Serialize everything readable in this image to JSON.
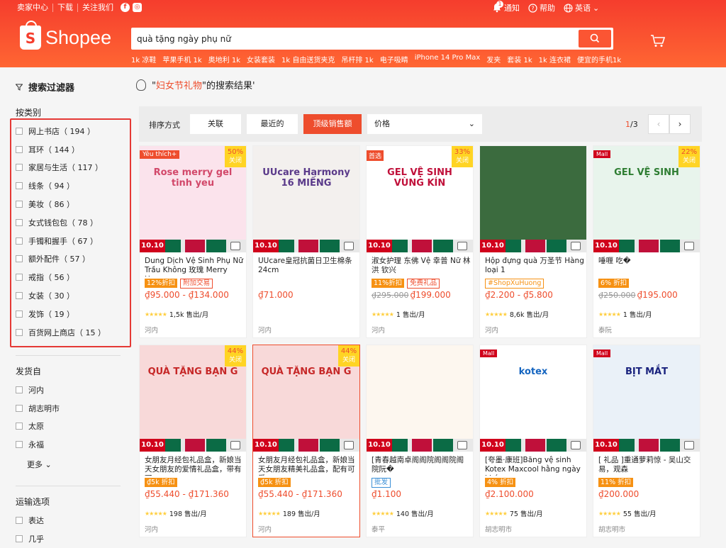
{
  "topbar": {
    "seller_center": "卖家中心",
    "download": "下载",
    "follow_us": "关注我们",
    "notifications": "通知",
    "notif_count": "1",
    "help": "帮助",
    "language": "英语"
  },
  "logo": {
    "text": "Shopee",
    "mark": "S"
  },
  "search": {
    "value": "quà tặng ngày phụ nữ",
    "placeholder": ""
  },
  "hints": [
    "1k 凉鞋",
    "苹果手机 1k",
    "奥地利 1k",
    "女装套装",
    "1k 自由送货夹克",
    "吊杆排 1k",
    "电子吸睛",
    "iPhone 14 Pro Max",
    "发夹",
    "套装 1k",
    "1k 连衣裙",
    "便宜的手机1k"
  ],
  "sidebar": {
    "filter_title": "搜索过滤器",
    "category_title": "按类别",
    "categories": [
      "网上书店（ 194 ）",
      "耳环（ 144 ）",
      "家居与生活（ 117 ）",
      "线条（ 94 ）",
      "美妆（ 86 ）",
      "女式钱包包（ 78 ）",
      "手镯和握手（ 67 ）",
      "额外配件（ 57 ）",
      "戒指（ 56 ）",
      "女装（ 30 ）",
      "发饰（ 19 ）",
      "百货网上商店（ 15 ）"
    ],
    "ship_title": "发货自",
    "ship_from": [
      "河内",
      "胡志明市",
      "太原",
      "永福"
    ],
    "more": "更多",
    "shipping_title": "运输选项",
    "shipping": [
      "表达",
      "几乎"
    ]
  },
  "results": {
    "prefix": "\"",
    "keyword": "妇女节礼物",
    "suffix": "\"的搜索结果'"
  },
  "sortbar": {
    "label": "排序方式",
    "relevance": "关联",
    "latest": "最近的",
    "top_sales": "顶级销售额",
    "price": "价格",
    "page_current": "1",
    "page_total": "/3",
    "prev": "‹",
    "next": "›"
  },
  "colors": {
    "brand": "#ee4d2d",
    "header": "#f53d2d",
    "highlight_frame": "#e53935"
  },
  "products": [
    {
      "badge": "Yêu thích+",
      "badge_type": "like",
      "discount": "50%",
      "discount_label": "关闭",
      "name": "Dung Dịch Vệ Sinh Phụ Nữ Trầu Không 玫瑰 Merry Hợ...",
      "chips": [
        {
          "t": "12%折扣",
          "c": "orange"
        },
        {
          "t": "附加交易",
          "c": "outline"
        }
      ],
      "old_price": "",
      "price": "₫95.000 - ₫134.000",
      "sold": "1,5k 售出/月",
      "location": "河内",
      "img_bg": "#fbe3ec",
      "img_text": "Rose merry gel tinh yeu",
      "img_color": "#d2486a"
    },
    {
      "badge": "",
      "badge_type": "",
      "discount": "",
      "discount_label": "",
      "name": "UUcare皇冠抗菌日卫生棉条 24cm",
      "chips": [],
      "old_price": "",
      "price": "₫71.000",
      "sold": "",
      "location": "河内",
      "img_bg": "#f3f0ee",
      "img_text": "UUcare Harmony 16 MIẾNG",
      "img_color": "#5a3a8a"
    },
    {
      "badge": "首选",
      "badge_type": "top",
      "discount": "33%",
      "discount_label": "关闭",
      "name": "淑女护理 东佛 Vệ 幸普 Nữ 林 洪 钦兴",
      "chips": [
        {
          "t": "11%折扣",
          "c": "orange"
        },
        {
          "t": "免费礼品",
          "c": "outline"
        }
      ],
      "old_price": "₫295.000",
      "price": "₫199.000",
      "sold": "1 售出/月",
      "location": "河内",
      "img_bg": "#ffffff",
      "img_text": "GEL VỆ SINH VÙNG KÍN",
      "img_color": "#c0103a"
    },
    {
      "badge": "",
      "badge_type": "",
      "discount": "",
      "discount_label": "",
      "name": "Hộp đựng quà 万圣节 Hàng loại 1",
      "chips": [
        {
          "t": "#ShopXuHuong",
          "c": "yellowout"
        }
      ],
      "old_price": "",
      "price": "₫2.200 - ₫5.800",
      "sold": "8,6k 售出/月",
      "location": "河内",
      "img_bg": "#3b6b3e",
      "img_text": "",
      "img_color": "#ffffff"
    },
    {
      "badge": "Mall",
      "badge_type": "mall",
      "discount": "22%",
      "discount_label": "关闭",
      "name": "唾喱 吃�",
      "chips": [
        {
          "t": "6% 折扣",
          "c": "orange"
        }
      ],
      "old_price": "₫250.000",
      "price": "₫195.000",
      "sold": "1 售出/月",
      "location": "泰阮",
      "img_bg": "#e8f4ec",
      "img_text": "GEL VỆ SINH",
      "img_color": "#2e7d32"
    },
    {
      "badge": "",
      "badge_type": "",
      "discount": "44%",
      "discount_label": "关闭",
      "name": "女朋友月经包礼品盒，新娘当天女朋友的爱情礼品盒，带有可...",
      "chips": [
        {
          "t": "₫5k 折扣",
          "c": "orange"
        }
      ],
      "old_price": "",
      "price": "₫55.440 - ₫171.360",
      "sold": "198 售出/月",
      "location": "河内",
      "img_bg": "#f8d9d9",
      "img_text": "QUÀ TẶNG BẠN G",
      "img_color": "#c62828"
    },
    {
      "badge": "",
      "badge_type": "",
      "discount": "44%",
      "discount_label": "关闭",
      "name": "女朋友月经包礼品盒，新娘当天女朋友精美礼品盒，配有可爱...",
      "chips": [
        {
          "t": "₫5k 折扣",
          "c": "orange"
        }
      ],
      "old_price": "",
      "price": "₫55.440 - ₫171.360",
      "sold": "189 售出/月",
      "location": "河内",
      "img_bg": "#f8d9d9",
      "img_text": "QUÀ TẶNG BẠN G",
      "img_color": "#c62828"
    },
    {
      "badge": "",
      "badge_type": "",
      "discount": "",
      "discount_label": "",
      "name": "[青春越南卓阁阁院阁阁院阁院阮�",
      "chips": [
        {
          "t": "批发",
          "c": "blue"
        }
      ],
      "old_price": "",
      "price": "₫1.100",
      "sold": "140 售出/月",
      "location": "泰平",
      "img_bg": "#fdf7ef",
      "img_text": "",
      "img_color": "#c2185b"
    },
    {
      "badge": "Mall",
      "badge_type": "mall",
      "discount": "",
      "discount_label": "",
      "name": "[夸墨·康班]Băng vệ sinh Kotex Maxcool hằng ngày kháng...",
      "chips": [
        {
          "t": "4% 折扣",
          "c": "orange"
        }
      ],
      "old_price": "",
      "price": "₫2.100.000",
      "sold": "75 售出/月",
      "location": "胡志明市",
      "img_bg": "#ffffff",
      "img_text": "kotex",
      "img_color": "#1565c0"
    },
    {
      "badge": "Mall",
      "badge_type": "mall",
      "discount": "",
      "discount_label": "",
      "name": "[ 礼品 ]重通萝莉惊 - 吴山交易，观森",
      "chips": [
        {
          "t": "11% 折扣",
          "c": "orange"
        }
      ],
      "old_price": "",
      "price": "₫200.000",
      "sold": "55 售出/月",
      "location": "胡志明市",
      "img_bg": "#eaf1f8",
      "img_text": "BỊT MẮT",
      "img_color": "#1a237e"
    }
  ],
  "strip_label": "10.10"
}
